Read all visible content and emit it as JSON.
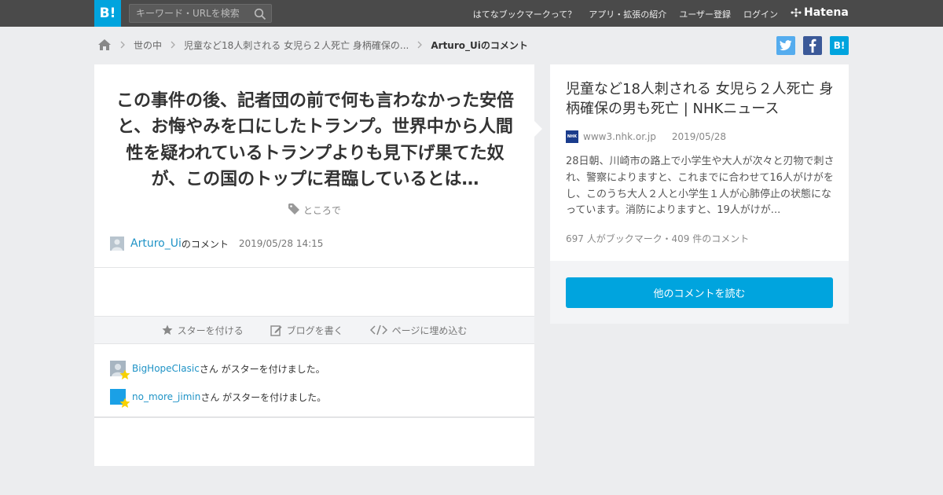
{
  "header": {
    "logo_text": "B!",
    "search_placeholder": "キーワード・URLを検索",
    "nav": [
      "はてなブックマークって？",
      "アプリ・拡張の紹介",
      "ユーザー登録",
      "ログイン"
    ],
    "brand": "Hatena"
  },
  "breadcrumb": {
    "items": [
      "世の中",
      "児童など18人刺される 女児ら２人死亡 身柄確保の..."
    ],
    "current": "Arturo_Uiのコメント"
  },
  "share": {
    "hatena_label": "B!"
  },
  "comment": {
    "text": "この事件の後、記者団の前で何も言わなかった安倍と、お悔やみを口にしたトランプ。世界中から人間性を疑われているトランプよりも見下げ果てた奴が、この国のトップに君臨しているとは…",
    "tag": "ところで",
    "author": "Arturo_Ui",
    "author_suffix": "のコメント",
    "date": "2019/05/28 14:15"
  },
  "actions": {
    "star": "スターを付ける",
    "blog": "ブログを書く",
    "embed": "ページに埋め込む"
  },
  "starers": [
    {
      "name": "BigHopeClasic",
      "text": "さん がスターを付けました。",
      "avatar_color": "#a7b5c1"
    },
    {
      "name": "no_more_jimin",
      "text": "さん がスターを付けました。",
      "avatar_color": "#1aa0e6"
    }
  ],
  "article": {
    "title": "児童など18人刺される 女児ら２人死亡 身柄確保の男も死亡 | NHKニュース",
    "favicon_text": "NHK",
    "domain": "www3.nhk.or.jp",
    "date": "2019/05/28",
    "summary": "28日朝、川崎市の路上で小学生や大人が次々と刃物で刺され、警察によりますと、これまでに合わせて16人がけがをし、このうち大人２人と小学生１人が心肺停止の状態になっています。消防によりますと、19人がけが...",
    "counts": "697 人がブックマーク・409 件のコメント",
    "read_more": "他のコメントを読む"
  },
  "colors": {
    "topbar": "#4a4a4a",
    "accent": "#00a4de",
    "link": "#1f93c6",
    "twitter": "#55acee",
    "facebook": "#3b5998",
    "star": "#f7d100"
  }
}
